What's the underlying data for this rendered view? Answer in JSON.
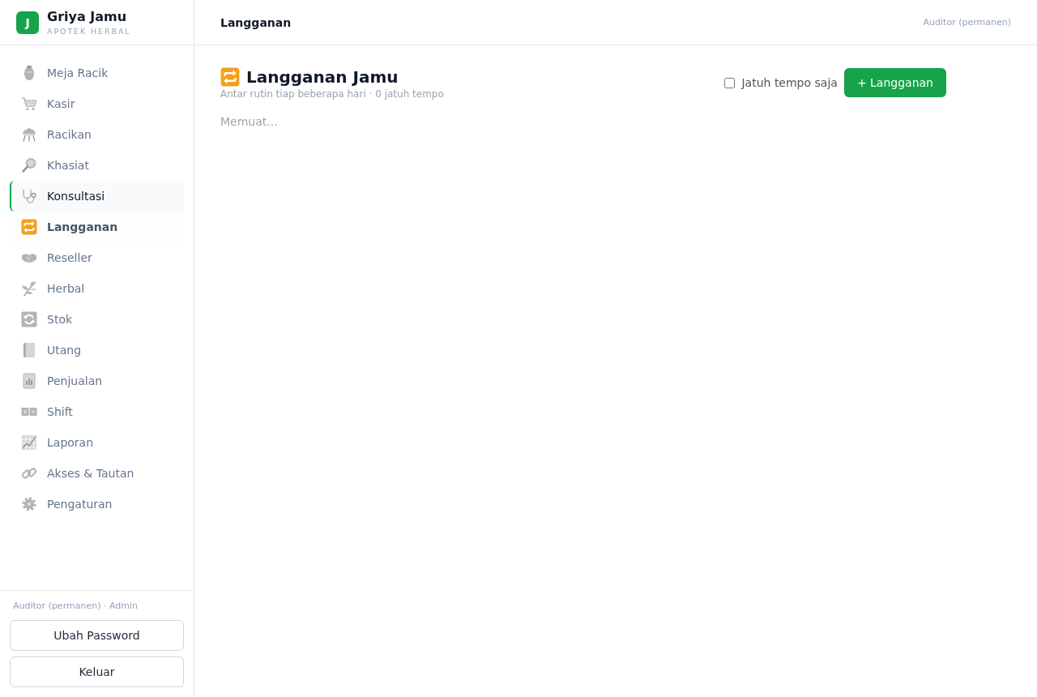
{
  "brand": {
    "logo_letter": "J",
    "name": "Griya Jamu",
    "tagline": "APOTEK HERBAL"
  },
  "sidebar": {
    "items": [
      {
        "label": "Meja Racik",
        "selected": false,
        "hovered": false
      },
      {
        "label": "Kasir",
        "selected": false,
        "hovered": false
      },
      {
        "label": "Racikan",
        "selected": false,
        "hovered": false
      },
      {
        "label": "Khasiat",
        "selected": false,
        "hovered": false
      },
      {
        "label": "Konsultasi",
        "selected": false,
        "hovered": true
      },
      {
        "label": "Langganan",
        "selected": true,
        "hovered": false
      },
      {
        "label": "Reseller",
        "selected": false,
        "hovered": false
      },
      {
        "label": "Herbal",
        "selected": false,
        "hovered": false
      },
      {
        "label": "Stok",
        "selected": false,
        "hovered": false
      },
      {
        "label": "Utang",
        "selected": false,
        "hovered": false
      },
      {
        "label": "Penjualan",
        "selected": false,
        "hovered": false
      },
      {
        "label": "Shift",
        "selected": false,
        "hovered": false
      },
      {
        "label": "Laporan",
        "selected": false,
        "hovered": false
      },
      {
        "label": "Akses & Tautan",
        "selected": false,
        "hovered": false
      },
      {
        "label": "Pengaturan",
        "selected": false,
        "hovered": false
      }
    ]
  },
  "sidebar_footer": {
    "caption": "Auditor (permanen) · Admin",
    "buttons": [
      "Ubah Password",
      "Keluar"
    ]
  },
  "header": {
    "title": "Langganan",
    "user": "Auditor (permanen)"
  },
  "page": {
    "title": "Langganan Jamu",
    "subtitle": "Antar rutin tiap beberapa hari · 0 jatuh tempo",
    "filter": {
      "label": "Jatuh tempo saja",
      "checked": false
    },
    "add_button": "+ Langganan",
    "status": "Memuat..."
  }
}
